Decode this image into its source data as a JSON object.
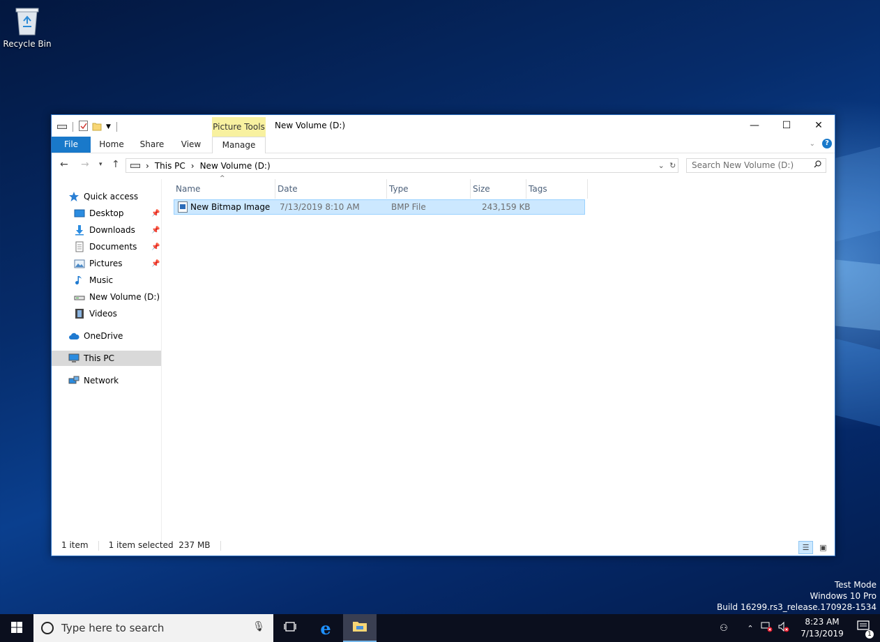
{
  "desktop": {
    "recycle_bin_label": "Recycle Bin",
    "watermark": [
      "Test Mode",
      "Windows 10 Pro",
      "Build 16299.rs3_release.170928-1534"
    ]
  },
  "window": {
    "context_tab": "Picture Tools",
    "title": "New Volume (D:)",
    "ribbon_tabs": [
      "File",
      "Home",
      "Share",
      "View",
      "Manage"
    ]
  },
  "address": {
    "crumbs": [
      "This PC",
      "New Volume (D:)"
    ],
    "search_placeholder": "Search New Volume (D:)"
  },
  "sidebar": {
    "items": [
      {
        "label": "Quick access",
        "icon": "star-icon"
      },
      {
        "label": "Desktop",
        "icon": "desktop-icon",
        "pinned": true
      },
      {
        "label": "Downloads",
        "icon": "download-icon",
        "pinned": true
      },
      {
        "label": "Documents",
        "icon": "documents-icon",
        "pinned": true
      },
      {
        "label": "Pictures",
        "icon": "pictures-icon",
        "pinned": true
      },
      {
        "label": "Music",
        "icon": "music-icon"
      },
      {
        "label": "New Volume (D:)",
        "icon": "drive-icon"
      },
      {
        "label": "Videos",
        "icon": "videos-icon"
      },
      {
        "label": "OneDrive",
        "icon": "cloud-icon"
      },
      {
        "label": "This PC",
        "icon": "computer-icon",
        "selected": true
      },
      {
        "label": "Network",
        "icon": "network-icon"
      }
    ]
  },
  "columns": [
    "Name",
    "Date",
    "Type",
    "Size",
    "Tags"
  ],
  "files": [
    {
      "name": "New Bitmap Image",
      "date": "7/13/2019 8:10 AM",
      "type": "BMP File",
      "size": "243,159 KB",
      "tags": ""
    }
  ],
  "status": {
    "count": "1 item",
    "selection": "1 item selected  237 MB"
  },
  "taskbar": {
    "search_placeholder": "Type here to search",
    "time": "8:23 AM",
    "date": "7/13/2019",
    "notification_count": "1"
  },
  "colors": {
    "accent": "#1979ca",
    "selection": "#cce8ff",
    "context_tab": "#f8f1a0"
  }
}
